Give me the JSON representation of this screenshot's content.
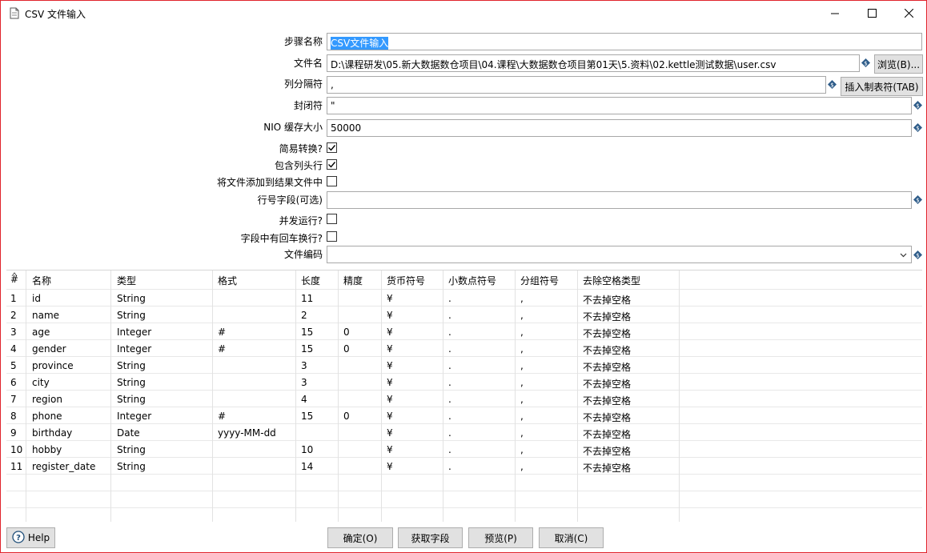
{
  "window": {
    "title": "CSV 文件输入"
  },
  "form": {
    "step_name_label": "步骤名称",
    "step_name_value": "CSV文件输入",
    "filename_label": "文件名",
    "filename_value": "D:\\课程研发\\05.新大数据数仓项目\\04.课程\\大数据数仓项目第01天\\5.资料\\02.kettle测试数据\\user.csv",
    "browse_button": "浏览(B)...",
    "delimiter_label": "列分隔符",
    "delimiter_value": ",",
    "insert_tab_button": "插入制表符(TAB)",
    "enclosure_label": "封闭符",
    "enclosure_value": "\"",
    "nio_label": "NIO 缓存大小",
    "nio_value": "50000",
    "lazy_label": "简易转换?",
    "lazy_checked": true,
    "header_label": "包含列头行",
    "header_checked": true,
    "add_result_label": "将文件添加到结果文件中",
    "add_result_checked": false,
    "rownum_label": "行号字段(可选)",
    "rownum_value": "",
    "parallel_label": "并发运行?",
    "parallel_checked": false,
    "newline_label": "字段中有回车换行?",
    "newline_checked": false,
    "encoding_label": "文件编码",
    "encoding_value": ""
  },
  "table": {
    "headers": [
      "#",
      "名称",
      "类型",
      "格式",
      "长度",
      "精度",
      "货币符号",
      "小数点符号",
      "分组符号",
      "去除空格类型"
    ],
    "rows": [
      [
        "1",
        "id",
        "String",
        "",
        "11",
        "",
        "¥",
        ".",
        ",",
        "不去掉空格"
      ],
      [
        "2",
        "name",
        "String",
        "",
        "2",
        "",
        "¥",
        ".",
        ",",
        "不去掉空格"
      ],
      [
        "3",
        "age",
        "Integer",
        "#",
        "15",
        "0",
        "¥",
        ".",
        ",",
        "不去掉空格"
      ],
      [
        "4",
        "gender",
        "Integer",
        "#",
        "15",
        "0",
        "¥",
        ".",
        ",",
        "不去掉空格"
      ],
      [
        "5",
        "province",
        "String",
        "",
        "3",
        "",
        "¥",
        ".",
        ",",
        "不去掉空格"
      ],
      [
        "6",
        "city",
        "String",
        "",
        "3",
        "",
        "¥",
        ".",
        ",",
        "不去掉空格"
      ],
      [
        "7",
        "region",
        "String",
        "",
        "4",
        "",
        "¥",
        ".",
        ",",
        "不去掉空格"
      ],
      [
        "8",
        "phone",
        "Integer",
        "#",
        "15",
        "0",
        "¥",
        ".",
        ",",
        "不去掉空格"
      ],
      [
        "9",
        "birthday",
        "Date",
        "yyyy-MM-dd",
        "",
        "",
        "¥",
        ".",
        ",",
        "不去掉空格"
      ],
      [
        "10",
        "hobby",
        "String",
        "",
        "10",
        "",
        "¥",
        ".",
        ",",
        "不去掉空格"
      ],
      [
        "11",
        "register_date",
        "String",
        "",
        "14",
        "",
        "¥",
        ".",
        ",",
        "不去掉空格"
      ]
    ]
  },
  "footer": {
    "help": "Help",
    "ok": "确定(O)",
    "get_fields": "获取字段",
    "preview": "预览(P)",
    "cancel": "取消(C)"
  },
  "colors": {
    "accent_border": "#e0242c",
    "selection": "#3399ff"
  }
}
